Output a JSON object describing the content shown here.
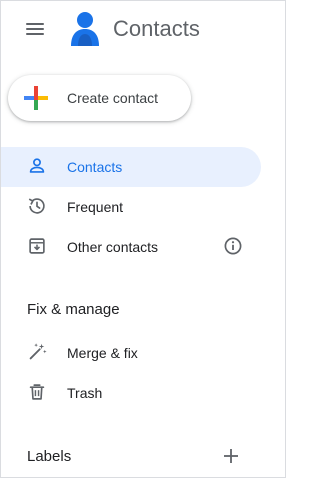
{
  "app": {
    "title": "Contacts"
  },
  "create_button": {
    "label": "Create contact"
  },
  "nav": {
    "items": [
      {
        "label": "Contacts",
        "icon": "person-outline-icon",
        "active": true
      },
      {
        "label": "Frequent",
        "icon": "history-icon",
        "active": false
      },
      {
        "label": "Other contacts",
        "icon": "archive-download-icon",
        "active": false
      }
    ]
  },
  "fix_manage": {
    "title": "Fix & manage",
    "items": [
      {
        "label": "Merge & fix",
        "icon": "magic-wand-icon"
      },
      {
        "label": "Trash",
        "icon": "trash-icon"
      }
    ]
  },
  "labels": {
    "title": "Labels"
  },
  "colors": {
    "accent": "#1a73e8",
    "active_bg": "#e8f0fe",
    "icon_gray": "#5f6368",
    "text": "#202124"
  }
}
